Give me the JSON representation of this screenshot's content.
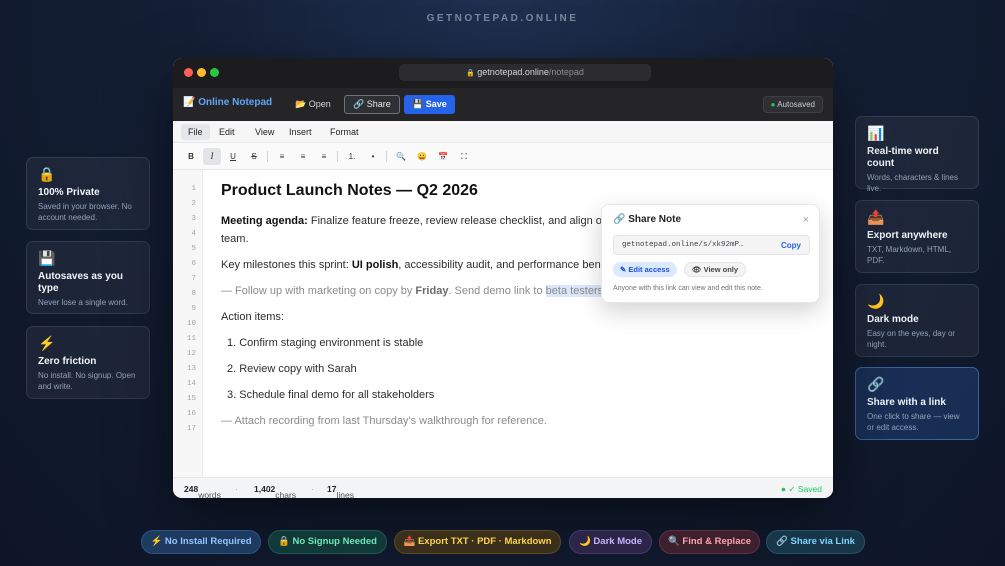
{
  "brand": "GETNOTEPAD.ONLINE",
  "colors": {
    "accent": "#2563eb",
    "saved": "#22c55e",
    "link": "#60a5fa"
  },
  "left_cards": [
    {
      "icon": "🔒",
      "icon_name": "lock-icon",
      "title": "100% Private",
      "desc": "Saved in your browser. No account needed."
    },
    {
      "icon": "💾",
      "icon_name": "floppy-disk-icon",
      "title": "Autosaves as you type",
      "desc": "Never lose a single word."
    },
    {
      "icon": "⚡",
      "icon_name": "lightning-icon",
      "title": "Zero friction",
      "desc": "No install. No signup. Open and write."
    }
  ],
  "right_cards": [
    {
      "icon": "📊",
      "icon_name": "bar-chart-icon",
      "title": "Real-time word count",
      "desc": "Words, characters & lines live."
    },
    {
      "icon": "📤",
      "icon_name": "outbox-icon",
      "title": "Export anywhere",
      "desc": "TXT, Markdown, HTML, PDF."
    },
    {
      "icon": "🌙",
      "icon_name": "moon-icon",
      "title": "Dark mode",
      "desc": "Easy on the eyes, day or night."
    },
    {
      "icon": "🔗",
      "icon_name": "link-icon",
      "title": "Share with a link",
      "desc": "One click to share — view or edit access."
    }
  ],
  "window": {
    "url_domain": "getnotepad.online",
    "url_path": "/notepad",
    "lock_icon": "🔒",
    "app_name": "📝 Online Notepad",
    "open_label": "📂 Open",
    "share_label": "🔗 Share",
    "save_label": "💾 Save",
    "autosaved_label": "Autosaved",
    "menus": [
      "File",
      "Edit",
      "View",
      "Insert",
      "Format"
    ],
    "toolbar": {
      "bold": "B",
      "italic": "I",
      "underline": "U",
      "strike": "S",
      "align_left": "≡",
      "align_center": "≡",
      "align_right": "≡",
      "numbered": "1.",
      "bullets": "•",
      "find": "🔍",
      "emoji": "😀",
      "date": "📅",
      "fullscreen": "⛶"
    },
    "line_numbers": [
      "1",
      "2",
      "3",
      "4",
      "5",
      "6",
      "7",
      "8",
      "9",
      "10",
      "11",
      "12",
      "13",
      "14",
      "15",
      "16",
      "17"
    ],
    "doc": {
      "title": "Product Launch Notes — Q2 2026",
      "p1_bold": "Meeting agenda:",
      "p1_text": " Finalize feature freeze, review release checklist, and align on",
      "p1_cont": "team.",
      "p2_pre": "Key milestones this sprint: ",
      "p2_bold": "UI polish",
      "p2_post": ", accessibility audit, and performance benc",
      "p3_pre": "— Follow up with marketing on copy by ",
      "p3_bold": "Friday",
      "p3_mid": ". Send demo link to ",
      "p3_sel": "beta testers",
      "action_heading": "Action items:",
      "items": [
        "1. Confirm staging environment is stable",
        "2. Review copy with Sarah",
        "3. Schedule final demo for all stakeholders"
      ],
      "footer_note": "— Attach recording from last Thursday's walkthrough for reference."
    },
    "status": {
      "words_value": "248",
      "words_label": " words",
      "chars_value": "1,402",
      "chars_label": " chars",
      "lines_value": "17",
      "lines_label": " lines",
      "separator": "·",
      "saved": "● ✓ Saved"
    }
  },
  "share_popover": {
    "title": "🔗 Share Note",
    "close": "×",
    "link": "getnotepad.online/s/xk92mP…",
    "copy_label": "Copy",
    "edit_label": "✎ Edit access",
    "view_label": "👁 View only",
    "note": "Anyone with this link can view and edit this note."
  },
  "bottom_pills": [
    {
      "label": "⚡ No Install Required",
      "color": "#93c5fd",
      "bg": "#1e3a5f",
      "border": "#2b5486"
    },
    {
      "label": "🔒 No Signup Needed",
      "color": "#6ee7b7",
      "bg": "#12393a",
      "border": "#1f5752"
    },
    {
      "label": "📤 Export TXT · PDF · Markdown",
      "color": "#fcd34d",
      "bg": "#3a2f1a",
      "border": "#5c4a25"
    },
    {
      "label": "🌙 Dark Mode",
      "color": "#c4b5fd",
      "bg": "#2c2547",
      "border": "#453a6e"
    },
    {
      "label": "🔍 Find & Replace",
      "color": "#fda4af",
      "bg": "#3d1f2e",
      "border": "#5f3046"
    },
    {
      "label": "🔗 Share via Link",
      "color": "#7dd3fc",
      "bg": "#173748",
      "border": "#24536b"
    }
  ]
}
